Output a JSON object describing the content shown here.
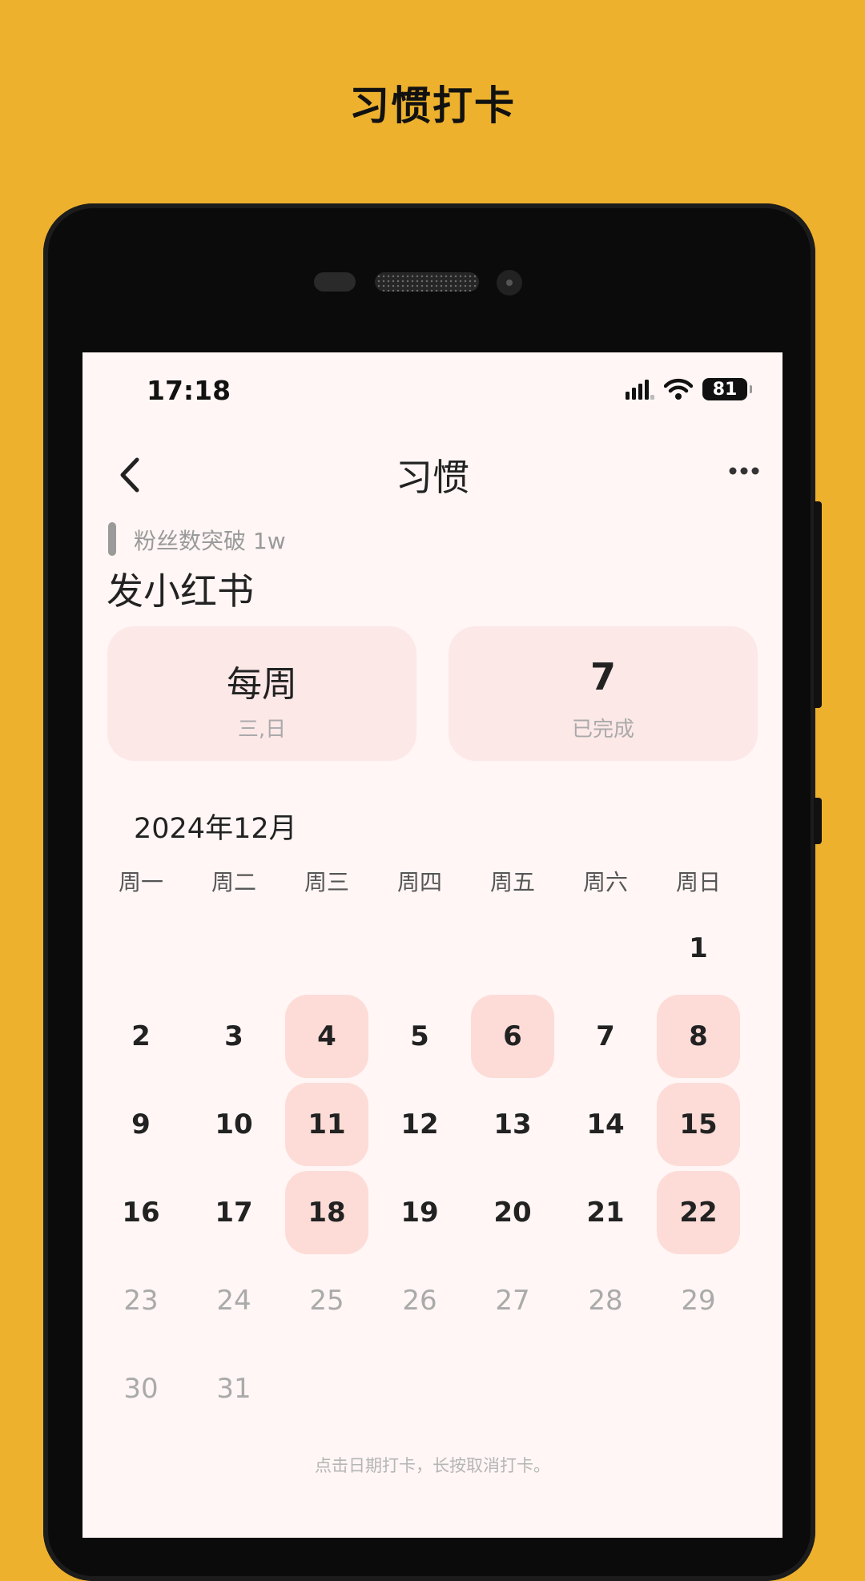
{
  "promo": {
    "title": "习惯打卡"
  },
  "status_bar": {
    "time": "17:18",
    "battery": "81"
  },
  "nav": {
    "title": "习惯"
  },
  "habit": {
    "subtitle": "粉丝数突破 1w",
    "name": "发小红书"
  },
  "cards": {
    "frequency_main": "每周",
    "frequency_days": "三,日",
    "completed_count": "7",
    "completed_label": "已完成"
  },
  "calendar": {
    "month_label": "2024年12月",
    "weekdays": [
      "周一",
      "周二",
      "周三",
      "周四",
      "周五",
      "周六",
      "周日"
    ],
    "days": [
      {
        "day": "1",
        "state": "normal"
      },
      {
        "day": "2",
        "state": "normal"
      },
      {
        "day": "3",
        "state": "normal"
      },
      {
        "day": "4",
        "state": "done"
      },
      {
        "day": "5",
        "state": "normal"
      },
      {
        "day": "6",
        "state": "done"
      },
      {
        "day": "7",
        "state": "normal"
      },
      {
        "day": "8",
        "state": "done"
      },
      {
        "day": "9",
        "state": "normal"
      },
      {
        "day": "10",
        "state": "normal"
      },
      {
        "day": "11",
        "state": "done"
      },
      {
        "day": "12",
        "state": "normal"
      },
      {
        "day": "13",
        "state": "normal"
      },
      {
        "day": "14",
        "state": "normal"
      },
      {
        "day": "15",
        "state": "done"
      },
      {
        "day": "16",
        "state": "normal"
      },
      {
        "day": "17",
        "state": "normal"
      },
      {
        "day": "18",
        "state": "done"
      },
      {
        "day": "19",
        "state": "normal"
      },
      {
        "day": "20",
        "state": "normal"
      },
      {
        "day": "21",
        "state": "normal"
      },
      {
        "day": "22",
        "state": "done"
      },
      {
        "day": "23",
        "state": "future"
      },
      {
        "day": "24",
        "state": "future"
      },
      {
        "day": "25",
        "state": "future"
      },
      {
        "day": "26",
        "state": "future"
      },
      {
        "day": "27",
        "state": "future"
      },
      {
        "day": "28",
        "state": "future"
      },
      {
        "day": "29",
        "state": "future"
      },
      {
        "day": "30",
        "state": "future"
      },
      {
        "day": "31",
        "state": "future"
      }
    ],
    "hint": "点击日期打卡，长按取消打卡。"
  },
  "icons": {
    "back": "chevron-left-icon",
    "more": "more-horizontal-icon",
    "signal": "signal-icon",
    "wifi": "wifi-icon",
    "battery": "battery-icon"
  },
  "colors": {
    "background": "#EDB12E",
    "screen": "#FFF6F5",
    "card": "#FDE8E8",
    "done_day": "#FDDCD7"
  }
}
